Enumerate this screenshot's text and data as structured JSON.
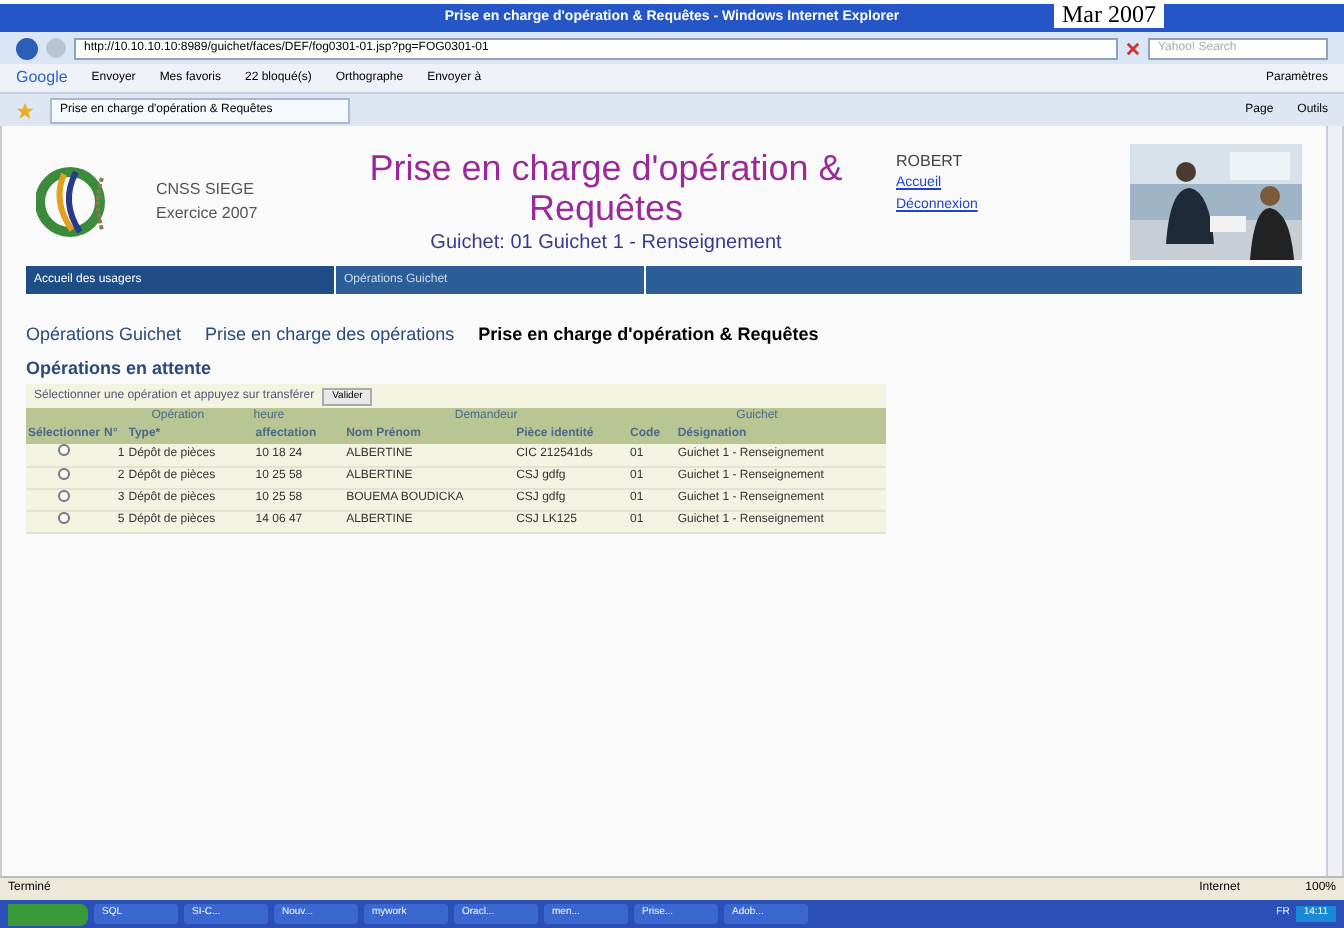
{
  "overlay_text": "Mar 2007",
  "window": {
    "title": "Prise en charge d'opération & Requêtes - Windows Internet Explorer"
  },
  "address_bar": {
    "url": "http://10.10.10.10:8989/guichet/faces/DEF/fog0301-01.jsp?pg=FOG0301-01",
    "search_placeholder": "Yahoo! Search"
  },
  "google_toolbar": {
    "logo": "Google",
    "items": [
      "Envoyer",
      "Mes favoris",
      "22 bloqué(s)",
      "Orthographe",
      "Envoyer à",
      "Paramètres"
    ]
  },
  "browser_tab": {
    "label": "Prise en charge d'opération & Requêtes"
  },
  "command_bar": [
    "Page",
    "Outils"
  ],
  "header": {
    "org": "CNSS SIEGE",
    "year": "Exercice 2007",
    "title": "Prise en charge d'opération & Requêtes",
    "subtitle": "Guichet: 01 Guichet 1 - Renseignement",
    "user": "ROBERT",
    "links": [
      "Accueil",
      "Déconnexion"
    ]
  },
  "nav": [
    {
      "label": "Accueil des usagers",
      "selected": true
    },
    {
      "label": "Opérations Guichet",
      "selected": false
    }
  ],
  "breadcrumbs": [
    {
      "label": "Opérations Guichet",
      "selected": false
    },
    {
      "label": "Prise en charge des opérations",
      "selected": false
    },
    {
      "label": "Prise en charge d'opération & Requêtes",
      "selected": true
    }
  ],
  "section_title": "Opérations en attente",
  "instruction": "Sélectionner une opération et appuyez sur transférer",
  "validate_button": "Valider",
  "table": {
    "groups": [
      "Opération",
      "heure",
      "Demandeur",
      "Guichet"
    ],
    "columns": [
      "Sélectionner",
      "N°",
      "Type*",
      "affectation",
      "Nom Prénom",
      "Pièce identité",
      "Code",
      "Désignation"
    ],
    "rows": [
      {
        "selected": false,
        "cells": [
          "",
          "1",
          "Dépôt de pièces",
          "10 18 24",
          "ALBERTINE",
          "CIC 212541ds",
          "01",
          "Guichet 1 - Renseignement"
        ]
      },
      {
        "selected": false,
        "cells": [
          "",
          "2",
          "Dépôt de pièces",
          "10 25 58",
          "ALBERTINE",
          "CSJ gdfg",
          "01",
          "Guichet 1 - Renseignement"
        ]
      },
      {
        "selected": false,
        "cells": [
          "",
          "3",
          "Dépôt de pièces",
          "10 25 58",
          "BOUEMA BOUDICKA",
          "CSJ gdfg",
          "01",
          "Guichet 1 - Renseignement"
        ]
      },
      {
        "selected": false,
        "cells": [
          "",
          "5",
          "Dépôt de pièces",
          "14 06 47",
          "ALBERTINE",
          "CSJ LK125",
          "01",
          "Guichet 1 - Renseignement"
        ]
      }
    ]
  },
  "status_bar": {
    "text": "Terminé",
    "zone": "Internet",
    "zoom": "100%"
  },
  "taskbar": {
    "items": [
      "SQL",
      "SI-C...",
      "Nouv...",
      "mywork",
      "Oracl...",
      "men...",
      "Prise...",
      "Adob..."
    ],
    "language": "FR",
    "clock": "14:11"
  }
}
